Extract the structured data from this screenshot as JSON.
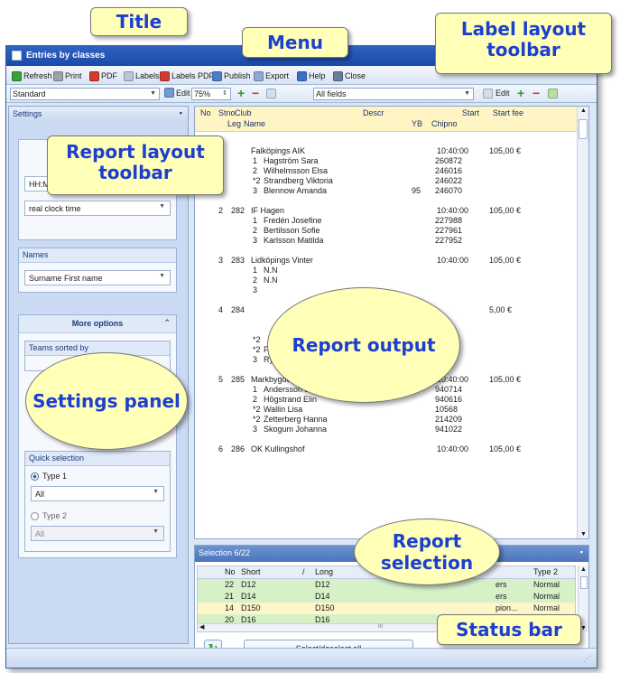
{
  "window": {
    "title": "Entries by classes"
  },
  "menu": {
    "items": [
      {
        "label": "Refresh",
        "icon": "refresh-icon",
        "color": "#3aa13a"
      },
      {
        "label": "Print",
        "icon": "print-icon",
        "color": "#9aa3ad"
      },
      {
        "label": "PDF",
        "icon": "pdf-icon",
        "color": "#d23a2a"
      },
      {
        "label": "Labels",
        "icon": "labels-icon",
        "color": "#b9c6d8"
      },
      {
        "label": "Labels PDF",
        "icon": "labels-pdf-icon",
        "color": "#d23a2a"
      },
      {
        "label": "Publish",
        "icon": "publish-icon",
        "color": "#4a7fd0"
      },
      {
        "label": "Export",
        "icon": "export-icon",
        "color": "#8fa9d4"
      },
      {
        "label": "Help",
        "icon": "help-icon",
        "color": "#3d6fc8"
      },
      {
        "label": "Close",
        "icon": "close-icon",
        "color": "#6b7d9a"
      }
    ]
  },
  "report_toolbar": {
    "layout": "Standard",
    "edit_label": "Edit",
    "zoom": "75%"
  },
  "label_toolbar": {
    "fields": "All fields",
    "edit_label": "Edit"
  },
  "settings": {
    "title": "Settings",
    "time_format": "HH:MM:SS",
    "time_mode": "real clock time",
    "names_group": "Names",
    "names_value": "Surname First name",
    "more_options": "More options",
    "teams_sorted_by": "Teams sorted by",
    "quick_selection": "Quick selection",
    "type1_label": "Type 1",
    "type1_value": "All",
    "type2_label": "Type 2",
    "type2_value": "All"
  },
  "report": {
    "headers": {
      "no": "No",
      "stno": "Stno",
      "leg": "Leg",
      "club": "Club",
      "name": "Name",
      "descr": "Descr",
      "yb": "YB",
      "start": "Start",
      "chipno": "Chipno",
      "start_fee": "Start fee"
    },
    "rows": [
      {
        "kind": "team",
        "no": "",
        "stno": "",
        "club": "Falköpings AIK",
        "start": "10:40:00",
        "fee": "105,00 €"
      },
      {
        "kind": "member",
        "leg": "1",
        "name": "Hagström Sara",
        "yb": "",
        "chip": "260872"
      },
      {
        "kind": "member",
        "leg": "2",
        "name": "Wilhelmsson Elsa",
        "yb": "",
        "chip": "246016"
      },
      {
        "kind": "member",
        "leg": "*2",
        "name": "Strandberg Viktoria",
        "yb": "",
        "chip": "246022"
      },
      {
        "kind": "member",
        "leg": "3",
        "name": "Blennow Amanda",
        "yb": "95",
        "chip": "246070"
      },
      {
        "kind": "blank"
      },
      {
        "kind": "team",
        "no": "2",
        "stno": "282",
        "club": "IF Hagen",
        "start": "10:40:00",
        "fee": "105,00 €"
      },
      {
        "kind": "member",
        "leg": "1",
        "name": "Fredén Josefine",
        "yb": "",
        "chip": "227988"
      },
      {
        "kind": "member",
        "leg": "2",
        "name": "Bertilsson Sofie",
        "yb": "",
        "chip": "227961"
      },
      {
        "kind": "member",
        "leg": "3",
        "name": "Karlsson Matilda",
        "yb": "",
        "chip": "227952"
      },
      {
        "kind": "blank"
      },
      {
        "kind": "team",
        "no": "3",
        "stno": "283",
        "club": "Lidköpings Vinter",
        "start": "10:40:00",
        "fee": "105,00 €"
      },
      {
        "kind": "member",
        "leg": "1",
        "name": "N.N",
        "yb": "",
        "chip": ""
      },
      {
        "kind": "member",
        "leg": "2",
        "name": "N.N",
        "yb": "",
        "chip": ""
      },
      {
        "kind": "member",
        "leg": "3",
        "name": "",
        "yb": "",
        "chip": ""
      },
      {
        "kind": "blank"
      },
      {
        "kind": "team",
        "no": "4",
        "stno": "284",
        "club": "",
        "start": "",
        "fee": "5,00 €"
      },
      {
        "kind": "blank"
      },
      {
        "kind": "blank"
      },
      {
        "kind": "member",
        "leg": "*2",
        "name": "",
        "yb": "",
        "chip": ""
      },
      {
        "kind": "member",
        "leg": "*2",
        "name": "F",
        "yb": "",
        "chip": ""
      },
      {
        "kind": "member",
        "leg": "3",
        "name": "Ryg",
        "yb": "",
        "chip": ""
      },
      {
        "kind": "blank"
      },
      {
        "kind": "team",
        "no": "5",
        "stno": "285",
        "club": "Markbygdens OK",
        "start": "10:40:00",
        "fee": "105,00 €"
      },
      {
        "kind": "member",
        "leg": "1",
        "name": "Andersson Josefin",
        "yb": "",
        "chip": "940714"
      },
      {
        "kind": "member",
        "leg": "2",
        "name": "Högstrand Elin",
        "yb": "",
        "chip": "940616"
      },
      {
        "kind": "member",
        "leg": "*2",
        "name": "Wallin Lisa",
        "yb": "",
        "chip": "10568"
      },
      {
        "kind": "member",
        "leg": "*2",
        "name": "Zetterberg Hanna",
        "yb": "",
        "chip": "214209"
      },
      {
        "kind": "member",
        "leg": "3",
        "name": "Skogum Johanna",
        "yb": "",
        "chip": "941022"
      },
      {
        "kind": "blank"
      },
      {
        "kind": "team",
        "no": "6",
        "stno": "286",
        "club": "OK Kullingshof",
        "start": "10:40:00",
        "fee": "105,00 €"
      }
    ]
  },
  "selection": {
    "title": "Selection 6/22",
    "headers": {
      "no": "No",
      "short": "Short",
      "long": "Long",
      "type2": "Type 2"
    },
    "rows": [
      {
        "no": "22",
        "short": "D12",
        "long": "D12",
        "type1": "ers",
        "type2": "Normal",
        "color": "#d6f0c8"
      },
      {
        "no": "21",
        "short": "D14",
        "long": "D14",
        "type1": "ers",
        "type2": "Normal",
        "color": "#d6f0c8"
      },
      {
        "no": "14",
        "short": "D150",
        "long": "D150",
        "type1": "pion...",
        "type2": "Normal",
        "color": "#fdf6c8"
      },
      {
        "no": "20",
        "short": "D16",
        "long": "D16",
        "type1": "posters",
        "type2": "Normal",
        "color": "#d6f0c8"
      }
    ],
    "select_all": "Select/deselect all"
  },
  "callouts": {
    "title": "Title",
    "menu": "Menu",
    "label_layout": "Label layout toolbar",
    "report_layout": "Report layout toolbar",
    "report_output": "Report output",
    "settings_panel": "Settings panel",
    "report_selection": "Report selection",
    "status_bar": "Status bar"
  }
}
